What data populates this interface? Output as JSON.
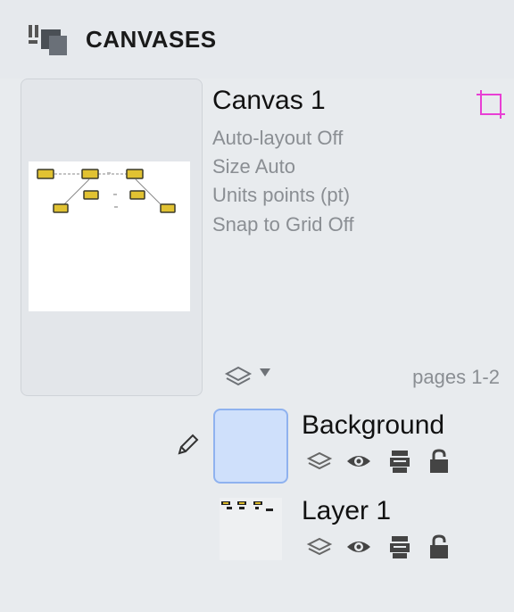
{
  "header": {
    "title": "CANVASES",
    "icon": "canvases-icon"
  },
  "canvas": {
    "name": "Canvas 1",
    "properties": [
      "Auto-layout Off",
      "Size Auto",
      "Units points (pt)",
      "Snap to Grid Off"
    ],
    "pages": "pages 1-2",
    "frame_icon": "canvas-frame-icon",
    "accent_color": "#e83fd4"
  },
  "layers": [
    {
      "name": "Background",
      "selected": true,
      "editing_icon": "pencil-icon",
      "icons": [
        "layer-stack-icon",
        "eye-icon",
        "printer-icon",
        "lock-icon"
      ],
      "swatch_color": "#cfe0fb"
    },
    {
      "name": "Layer 1",
      "selected": false,
      "icons": [
        "layer-stack-icon",
        "eye-icon",
        "printer-icon",
        "lock-icon"
      ]
    }
  ]
}
